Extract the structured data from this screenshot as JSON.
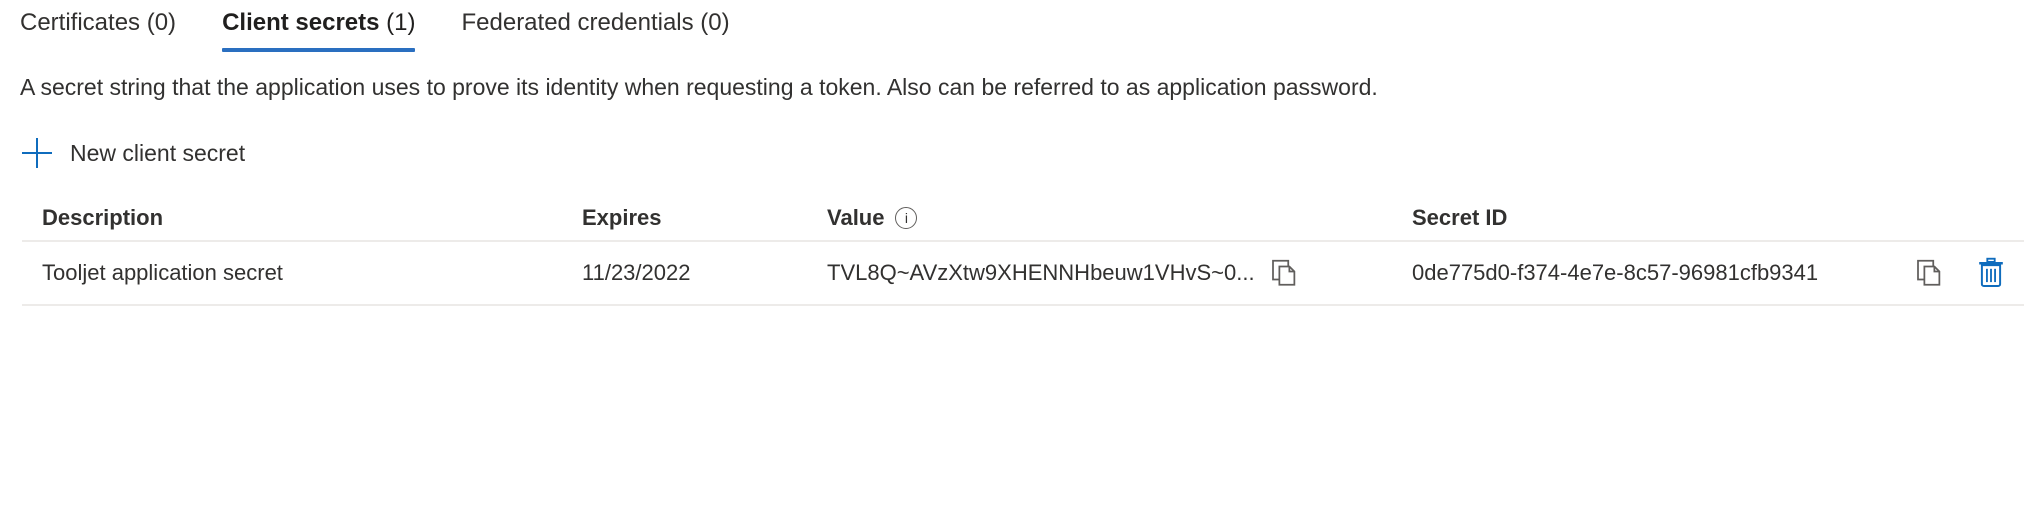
{
  "tabs": [
    {
      "label": "Certificates",
      "count": "(0)",
      "selected": false,
      "name": "tab-certificates"
    },
    {
      "label": "Client secrets",
      "count": "(1)",
      "selected": true,
      "name": "tab-client-secrets"
    },
    {
      "label": "Federated credentials",
      "count": "(0)",
      "selected": false,
      "name": "tab-federated-credentials"
    }
  ],
  "description": "A secret string that the application uses to prove its identity when requesting a token. Also can be referred to as application password.",
  "command_bar": {
    "new_secret_label": "New client secret",
    "plus_icon": "plus-icon"
  },
  "table": {
    "columns": {
      "description": "Description",
      "expires": "Expires",
      "value": "Value",
      "value_info_icon": "i",
      "secret_id": "Secret ID"
    },
    "rows": [
      {
        "description": "Tooljet application secret",
        "expires": "11/23/2022",
        "value": "TVL8Q~AVzXtw9XHENNHbeuw1VHvS~0...",
        "secret_id": "0de775d0-f374-4e7e-8c57-96981cfb9341",
        "value_copy_icon": "copy-icon",
        "secret_id_copy_icon": "copy-icon",
        "delete_icon": "trash-icon"
      }
    ]
  },
  "colors": {
    "accent": "#2a6fc0",
    "link": "#0f6cbd",
    "text": "#323130",
    "divider": "#edebe9",
    "icon_gray": "#605e5c",
    "icon_blue": "#0f6cbd"
  }
}
